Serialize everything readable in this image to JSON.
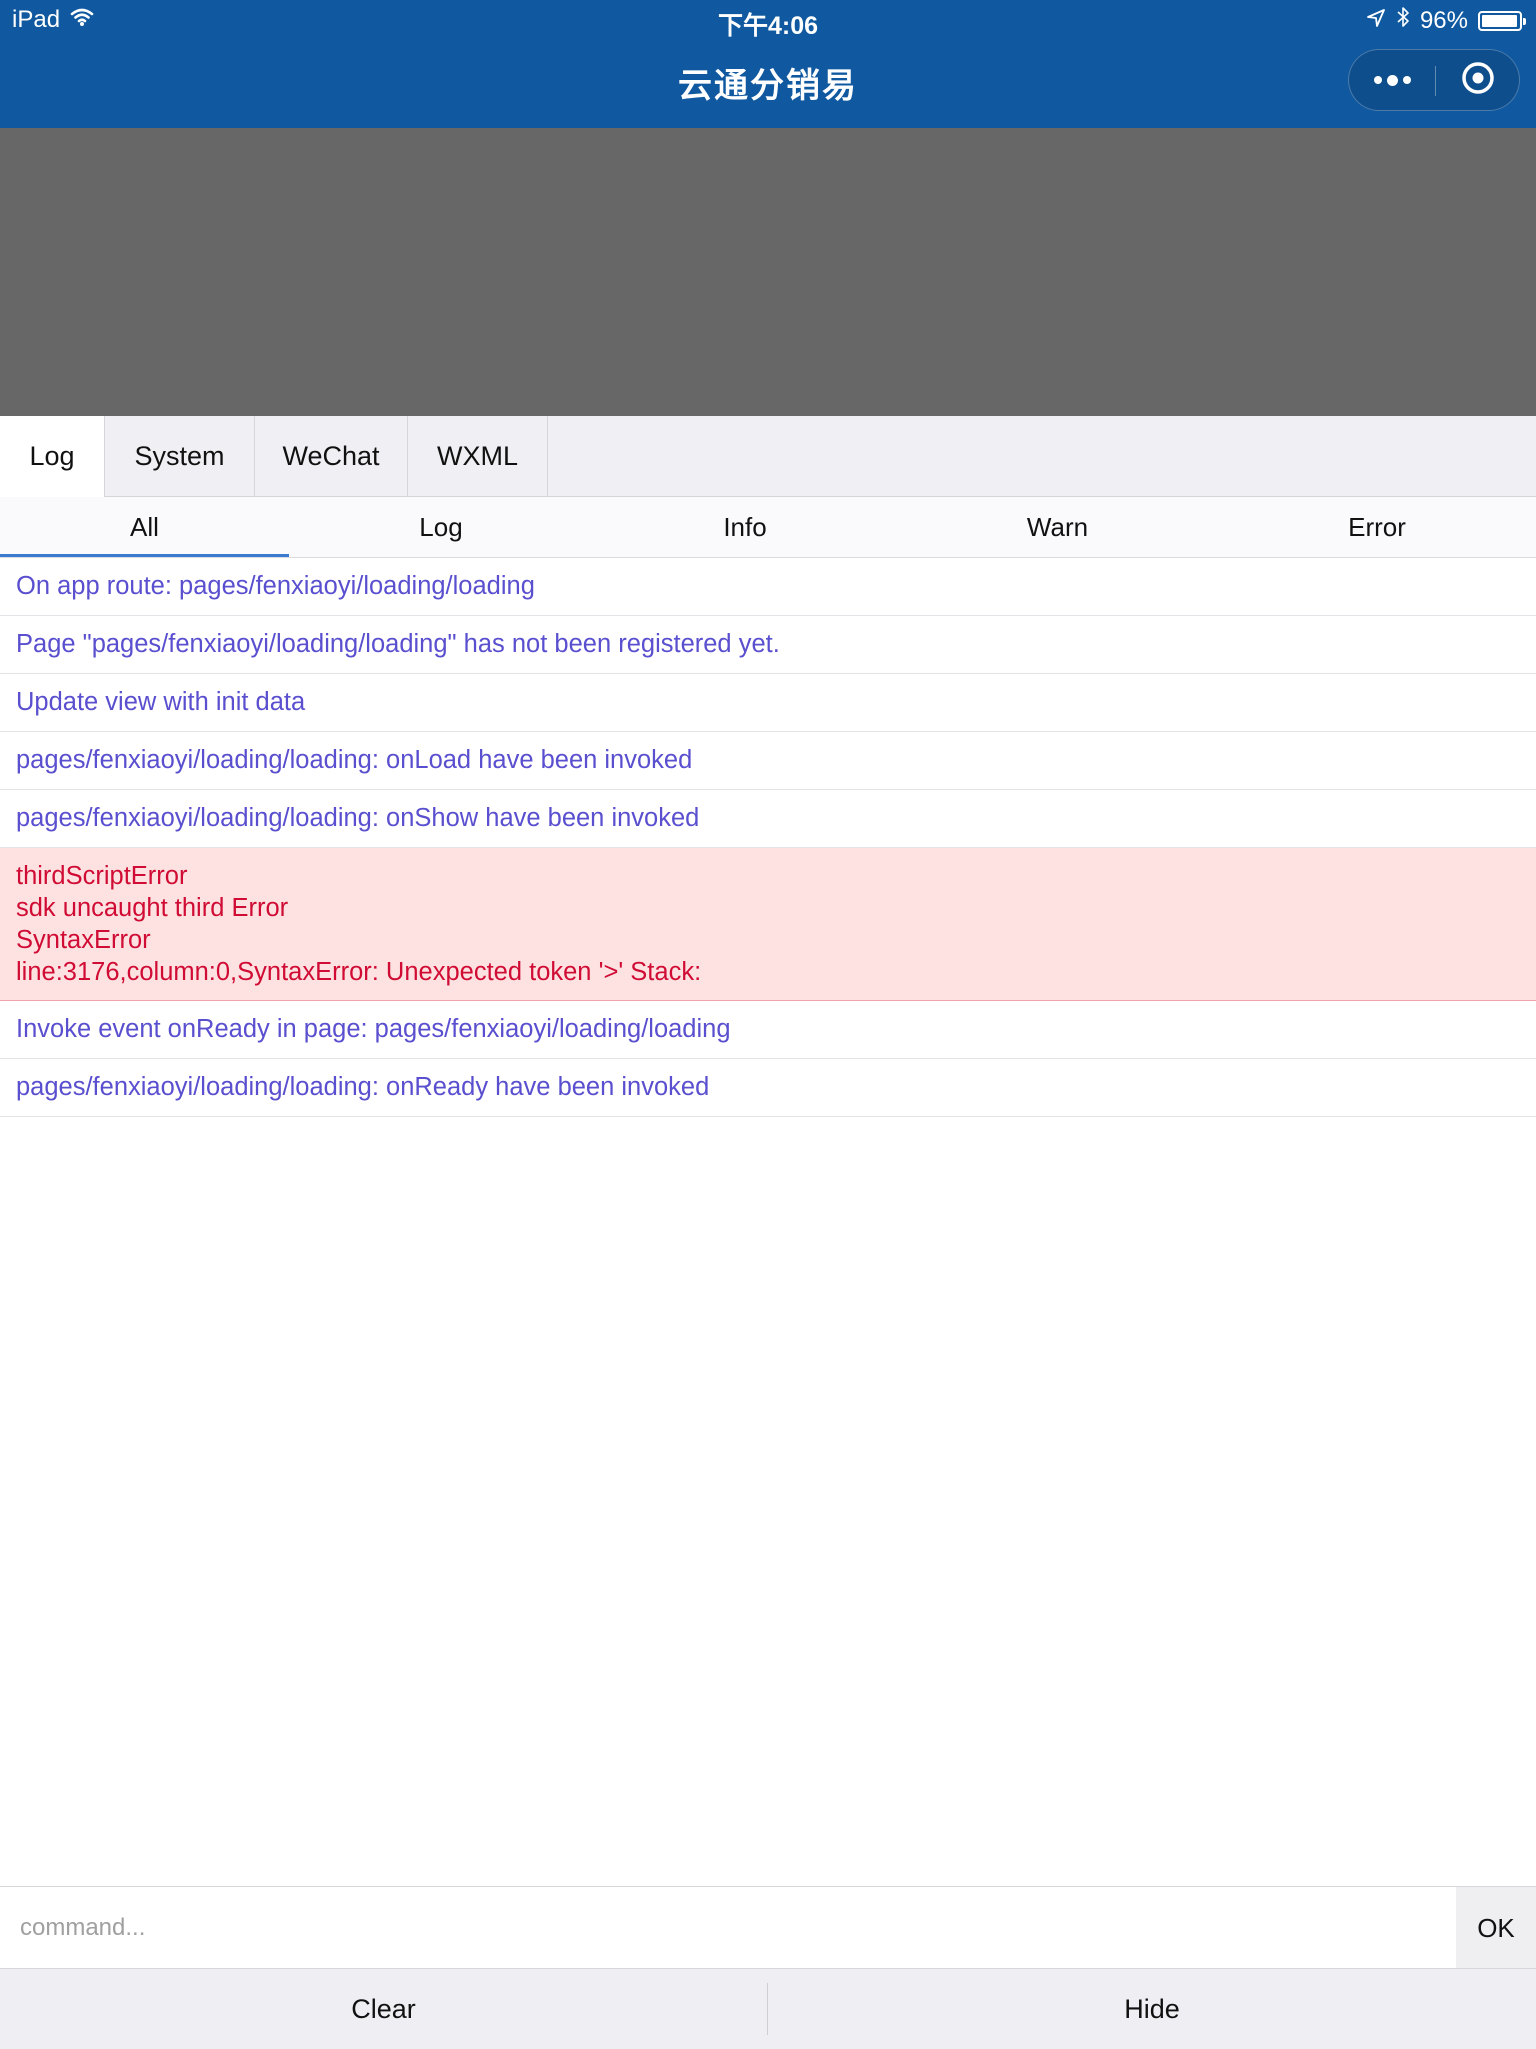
{
  "status_bar": {
    "device": "iPad",
    "time": "下午4:06",
    "battery_text": "96%",
    "battery_level": 0.96,
    "icons": [
      "wifi-icon",
      "location-arrow-icon",
      "bluetooth-icon",
      "battery-icon"
    ]
  },
  "nav": {
    "title": "云通分销易",
    "capsule_icons": [
      "more-dots-icon",
      "close-circle-icon"
    ]
  },
  "tabs": [
    {
      "label": "Log",
      "active": true
    },
    {
      "label": "System",
      "active": false
    },
    {
      "label": "WeChat",
      "active": false
    },
    {
      "label": "WXML",
      "active": false
    }
  ],
  "filters": [
    {
      "label": "All",
      "active": true
    },
    {
      "label": "Log",
      "active": false
    },
    {
      "label": "Info",
      "active": false
    },
    {
      "label": "Warn",
      "active": false
    },
    {
      "label": "Error",
      "active": false
    }
  ],
  "logs": [
    {
      "text": "On app route: pages/fenxiaoyi/loading/loading"
    },
    {
      "text": "Page \"pages/fenxiaoyi/loading/loading\" has not been registered yet."
    },
    {
      "text": "Update view with init data"
    },
    {
      "text": "pages/fenxiaoyi/loading/loading: onLoad have been invoked"
    },
    {
      "text": "pages/fenxiaoyi/loading/loading: onShow have been invoked"
    },
    {
      "type": "error",
      "lines": [
        "thirdScriptError",
        "sdk uncaught third Error",
        "SyntaxError",
        "line:3176,column:0,SyntaxError: Unexpected token '>' Stack:"
      ]
    },
    {
      "text": "Invoke event onReady in page: pages/fenxiaoyi/loading/loading"
    },
    {
      "text": "pages/fenxiaoyi/loading/loading: onReady have been invoked"
    }
  ],
  "command": {
    "placeholder": "command...",
    "value": "",
    "ok_label": "OK"
  },
  "bottom": {
    "clear_label": "Clear",
    "hide_label": "Hide"
  },
  "colors": {
    "nav_bg": "#1059a0",
    "log_text": "#5a4fcf",
    "error_text": "#d00c34",
    "error_bg": "#fee2e2",
    "active_underline": "#3b7ad1"
  }
}
